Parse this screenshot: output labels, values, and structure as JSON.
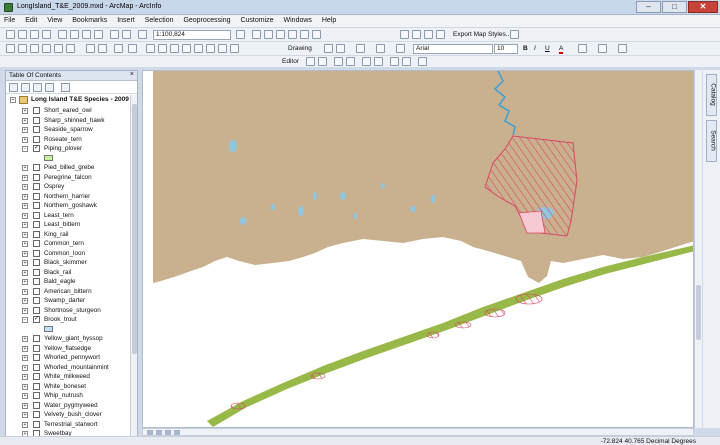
{
  "window": {
    "title": "LongIsland_T&E_2009.mxd - ArcMap - ArcInfo",
    "minimize": "–",
    "maximize": "□",
    "close": "✕"
  },
  "menu": [
    "File",
    "Edit",
    "View",
    "Bookmarks",
    "Insert",
    "Selection",
    "Geoprocessing",
    "Customize",
    "Windows",
    "Help"
  ],
  "toolbar": {
    "scale": "1:100,824",
    "export_map_styles": "Export Map Styles...",
    "drawing": "Drawing",
    "font_name": "Arial",
    "font_size": "10",
    "bold": "B",
    "italic": "I",
    "underline": "U",
    "font_color_glyph": "A",
    "editor": "Editor"
  },
  "toc": {
    "title": "Table Of Contents",
    "close": "×",
    "group": "Long Island T&E Species - 2009",
    "layers": [
      {
        "name": "Short_eared_owl",
        "checked": false,
        "expanded": false
      },
      {
        "name": "Sharp_shinned_hawk",
        "checked": false,
        "expanded": false
      },
      {
        "name": "Seaside_sparrow",
        "checked": false,
        "expanded": false
      },
      {
        "name": "Roseate_tern",
        "checked": false,
        "expanded": false
      },
      {
        "name": "Piping_plover",
        "checked": true,
        "expanded": true,
        "swatch": "#c8f0a0"
      },
      {
        "name": "Pied_billed_grebe",
        "checked": false,
        "expanded": false
      },
      {
        "name": "Peregrine_falcon",
        "checked": false,
        "expanded": false
      },
      {
        "name": "Osprey",
        "checked": false,
        "expanded": false
      },
      {
        "name": "Northern_harrier",
        "checked": false,
        "expanded": false
      },
      {
        "name": "Northern_goshawk",
        "checked": false,
        "expanded": false
      },
      {
        "name": "Least_tern",
        "checked": false,
        "expanded": false
      },
      {
        "name": "Least_bittern",
        "checked": false,
        "expanded": false
      },
      {
        "name": "King_rail",
        "checked": false,
        "expanded": false
      },
      {
        "name": "Common_tern",
        "checked": false,
        "expanded": false
      },
      {
        "name": "Common_loon",
        "checked": false,
        "expanded": false
      },
      {
        "name": "Black_skimmer",
        "checked": false,
        "expanded": false
      },
      {
        "name": "Black_rail",
        "checked": false,
        "expanded": false
      },
      {
        "name": "Bald_eagle",
        "checked": false,
        "expanded": false
      },
      {
        "name": "American_bittern",
        "checked": false,
        "expanded": false
      },
      {
        "name": "Swamp_darter",
        "checked": false,
        "expanded": false
      },
      {
        "name": "Shortnose_sturgeon",
        "checked": false,
        "expanded": false
      },
      {
        "name": "Brook_trout",
        "checked": true,
        "expanded": true,
        "swatch": "#bfe3f5"
      },
      {
        "name": "Yellow_giant_hyssop",
        "checked": false,
        "expanded": false
      },
      {
        "name": "Yellow_flatsedge",
        "checked": false,
        "expanded": false
      },
      {
        "name": "Whorled_pennywort",
        "checked": false,
        "expanded": false
      },
      {
        "name": "Whorled_mountainmint",
        "checked": false,
        "expanded": false
      },
      {
        "name": "White_milkweed",
        "checked": false,
        "expanded": false
      },
      {
        "name": "White_boneset",
        "checked": false,
        "expanded": false
      },
      {
        "name": "Whip_nutrush",
        "checked": false,
        "expanded": false
      },
      {
        "name": "Water_pygmyweed",
        "checked": false,
        "expanded": false
      },
      {
        "name": "Velvety_bush_clover",
        "checked": false,
        "expanded": false
      },
      {
        "name": "Terrestrial_starwort",
        "checked": false,
        "expanded": false
      },
      {
        "name": "Sweetbay",
        "checked": false,
        "expanded": false
      }
    ]
  },
  "side_tabs": [
    "Catalog",
    "Search"
  ],
  "status": {
    "coordinates": "-72.824  40.765 Decimal Degrees"
  },
  "colors": {
    "land": "#c9b08f",
    "water": "#ffffff",
    "lake": "#8ec7df",
    "river": "#3aa0d8",
    "habitat_hatch": "#d9485f",
    "beach": "#98b848"
  }
}
